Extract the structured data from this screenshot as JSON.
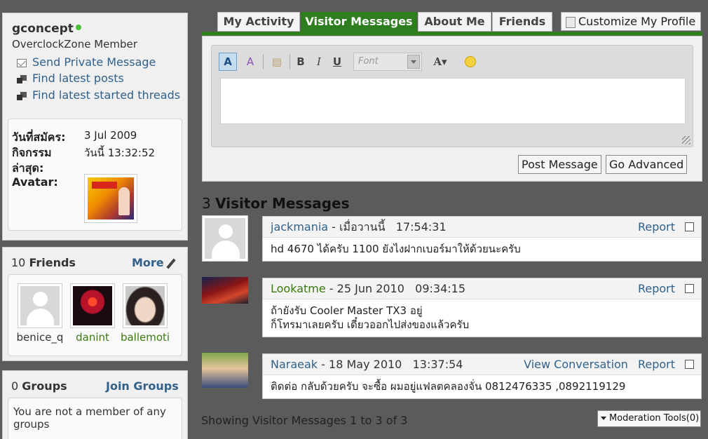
{
  "profile": {
    "username": "gconcept",
    "usertitle": "OverclockZone Member",
    "links": [
      "Send Private Message",
      "Find latest posts",
      "Find latest started threads"
    ],
    "join_label": "วันที่สมัคร:",
    "join_value": "3 Jul 2009",
    "activity_label_1": "กิจกรรม",
    "activity_label_2": "ล่าสุด:",
    "activity_value": "วันนี้ 13:32:52",
    "avatar_label": "Avatar:"
  },
  "friends": {
    "count": "10",
    "label": "Friends",
    "more": "More",
    "items": [
      {
        "name": "benice_q"
      },
      {
        "name": "danint"
      },
      {
        "name": "ballemoti"
      }
    ]
  },
  "groups": {
    "count": "0",
    "label": "Groups",
    "join": "Join Groups",
    "message": "You are not a member of any groups"
  },
  "tabs": [
    {
      "label": "My Activity"
    },
    {
      "label": "Visitor Messages"
    },
    {
      "label": "About Me"
    },
    {
      "label": "Friends"
    }
  ],
  "customize_label": "Customize My Profile",
  "editor": {
    "font_placeholder": "Font",
    "post_button": "Post Message",
    "advanced_button": "Go Advanced"
  },
  "visitor_messages": {
    "count": "3",
    "title": "Visitor Messages",
    "report_label": "Report",
    "view_conversation_label": "View Conversation",
    "items": [
      {
        "user": "jackmania",
        "date": "เมื่อวานนี้",
        "time": "17:54:31",
        "body_1": "hd 4670 ได้ครับ 1100 ยังไงฝากเบอร์มาให้ด้วยนะครับ",
        "body_2": ""
      },
      {
        "user": "Lookatme",
        "date": "25 Jun 2010",
        "time": "09:34:15",
        "body_1": "ถ้ายังรับ Cooler Master TX3 อยู่",
        "body_2": "ก็โทรมาเลยครับ เดี๋ยวออกไปส่งของแล้วครับ"
      },
      {
        "user": "Naraeak",
        "date": "18 May 2010",
        "time": "13:37:54",
        "body_1": "ติดต่อ กลับด้วยครับ จะซื้อ ผมอยู่แฟลตคลองจั่น 0812476335 ,0892119129",
        "body_2": ""
      }
    ],
    "showing": "Showing Visitor Messages 1 to 3 of 3",
    "moderation": "Moderation Tools(0)"
  }
}
